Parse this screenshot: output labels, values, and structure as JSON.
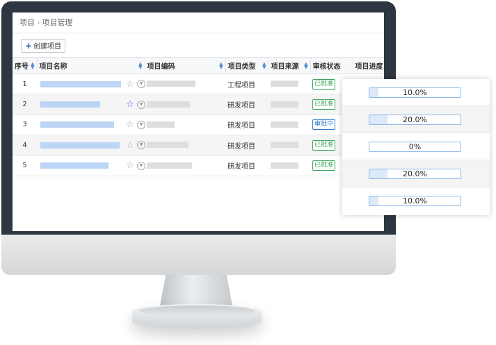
{
  "breadcrumb": {
    "root": "项目",
    "separator": "›",
    "current": "项目管理"
  },
  "toolbar": {
    "create_label": "创建项目",
    "create_icon": "plus-icon"
  },
  "table": {
    "headers": {
      "index": "序号",
      "name": "项目名称",
      "code": "项目编码",
      "type": "项目类型",
      "source": "项目来源",
      "status": "审核状态",
      "progress": "项目进度"
    },
    "rows": [
      {
        "index": "1",
        "type": "工程项目",
        "status": "已批准",
        "favorite": false
      },
      {
        "index": "2",
        "type": "研发项目",
        "status": "已批准",
        "favorite": true
      },
      {
        "index": "3",
        "type": "研发项目",
        "status": "审批中",
        "favorite": false
      },
      {
        "index": "4",
        "type": "研发项目",
        "status": "已批准",
        "favorite": false
      },
      {
        "index": "5",
        "type": "研发项目",
        "status": "已批准",
        "favorite": false
      }
    ]
  },
  "progress_popup": [
    {
      "label": "10.0%",
      "value": 0.1
    },
    {
      "label": "20.0%",
      "value": 0.2
    },
    {
      "label": "0%",
      "value": 0.0
    },
    {
      "label": "20.0%",
      "value": 0.2
    },
    {
      "label": "10.0%",
      "value": 0.1
    }
  ],
  "colors": {
    "approved": "#3aa55b",
    "pending": "#2f77d1",
    "accent": "#1b68c5",
    "bezel": "#2d3641"
  }
}
